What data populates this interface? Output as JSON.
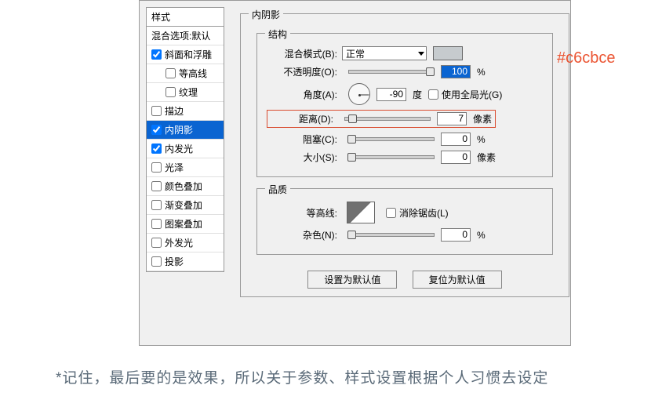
{
  "styles_header": "样式",
  "styles": [
    {
      "label": "混合选项:默认",
      "checked": false,
      "nocheck": true
    },
    {
      "label": "斜面和浮雕",
      "checked": true
    },
    {
      "label": "等高线",
      "checked": false,
      "indent": true
    },
    {
      "label": "纹理",
      "checked": false,
      "indent": true
    },
    {
      "label": "描边",
      "checked": false
    },
    {
      "label": "内阴影",
      "checked": true,
      "selected": true
    },
    {
      "label": "内发光",
      "checked": true
    },
    {
      "label": "光泽",
      "checked": false
    },
    {
      "label": "颜色叠加",
      "checked": false
    },
    {
      "label": "渐变叠加",
      "checked": false
    },
    {
      "label": "图案叠加",
      "checked": false
    },
    {
      "label": "外发光",
      "checked": false
    },
    {
      "label": "投影",
      "checked": false
    }
  ],
  "panel_title": "内阴影",
  "struct_title": "结构",
  "blend_label": "混合模式(B):",
  "blend_value": "正常",
  "opacity_label": "不透明度(O):",
  "opacity_value": "100",
  "opacity_unit": "%",
  "angle_label": "角度(A):",
  "angle_value": "-90",
  "angle_unit": "度",
  "global_light_label": "使用全局光(G)",
  "distance_label": "距离(D):",
  "distance_value": "7",
  "distance_unit": "像素",
  "choke_label": "阻塞(C):",
  "choke_value": "0",
  "choke_unit": "%",
  "size_label": "大小(S):",
  "size_value": "0",
  "size_unit": "像素",
  "quality_title": "品质",
  "contour_label": "等高线:",
  "antialias_label": "消除锯齿(L)",
  "noise_label": "杂色(N):",
  "noise_value": "0",
  "noise_unit": "%",
  "btn_default": "设置为默认值",
  "btn_reset": "复位为默认值",
  "color_annotation": "#c6cbce",
  "footer": "*记住，最后要的是效果，所以关于参数、样式设置根据个人习惯去设定"
}
